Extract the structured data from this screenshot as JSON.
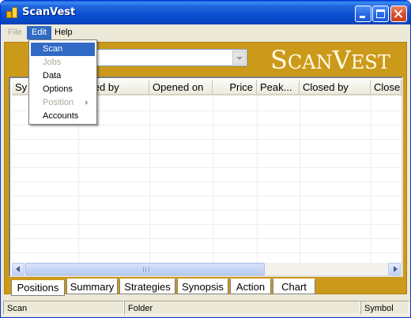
{
  "window": {
    "title": "ScanVest"
  },
  "menubar": {
    "file": "File",
    "edit": "Edit",
    "help": "Help"
  },
  "edit_menu": {
    "items": [
      {
        "label": "Scan",
        "state": "highlighted"
      },
      {
        "label": "Jobs",
        "state": "disabled"
      },
      {
        "label": "Data",
        "state": "enabled"
      },
      {
        "label": "Options",
        "state": "enabled"
      },
      {
        "label": "Position",
        "state": "disabled",
        "submenu": true
      },
      {
        "label": "Accounts",
        "state": "enabled"
      }
    ]
  },
  "banner": {
    "combo_value": "",
    "brand_first": "S",
    "brand_mid": "CAN",
    "brand_second": "V",
    "brand_end": "EST"
  },
  "grid": {
    "columns": [
      "Sy",
      "Opened by",
      "Opened on",
      "Price",
      "Peak...",
      "Closed by",
      "Close"
    ],
    "row_count": 12
  },
  "tabs": {
    "active": "Positions",
    "items": [
      "Positions",
      "Summary",
      "Strategies",
      "Synopsis",
      "Action",
      "Chart"
    ]
  },
  "statusbar": {
    "left": "Scan",
    "middle": "Folder",
    "right": "Symbol"
  },
  "colors": {
    "titlebar": "#0a4fd0",
    "banner": "#cc9a1b",
    "selection": "#316ac5"
  }
}
